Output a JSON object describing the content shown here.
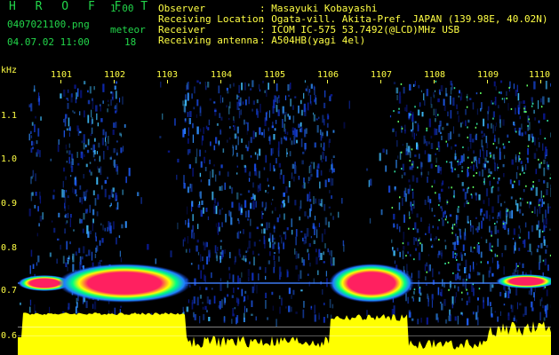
{
  "header": {
    "logo": "H R O F F T",
    "version": "1.00",
    "filename": "0407021100.png",
    "meteor_label": "meteor",
    "datetime": "04.07.02 11:00",
    "meteor_count": "18"
  },
  "info": [
    {
      "label": "Observer",
      "value": ": Masayuki Kobayashi"
    },
    {
      "label": "Receiving Location",
      "value": ": Ogata-vill. Akita-Pref. JAPAN (139.98E, 40.02N)"
    },
    {
      "label": "Receiver",
      "value": ": ICOM IC-575 53.7492(@LCD)MHz USB"
    },
    {
      "label": "Receiving antenna",
      "value": ": A504HB(yagi 4el)"
    }
  ],
  "spectrogram": {
    "y_unit": "kHz",
    "y_ticks": [
      "1.1",
      "1.0",
      "0.9",
      "0.8",
      "0.7",
      "0.6"
    ],
    "x_ticks": [
      "1101",
      "1102",
      "1103",
      "1104",
      "1105",
      "1106",
      "1107",
      "1108",
      "1109",
      "1110"
    ],
    "colors": {
      "background": "#000000",
      "noise": "#1030c0",
      "signal": "#ff2060",
      "level": "#ffff00",
      "axis": "#ffff44"
    }
  }
}
